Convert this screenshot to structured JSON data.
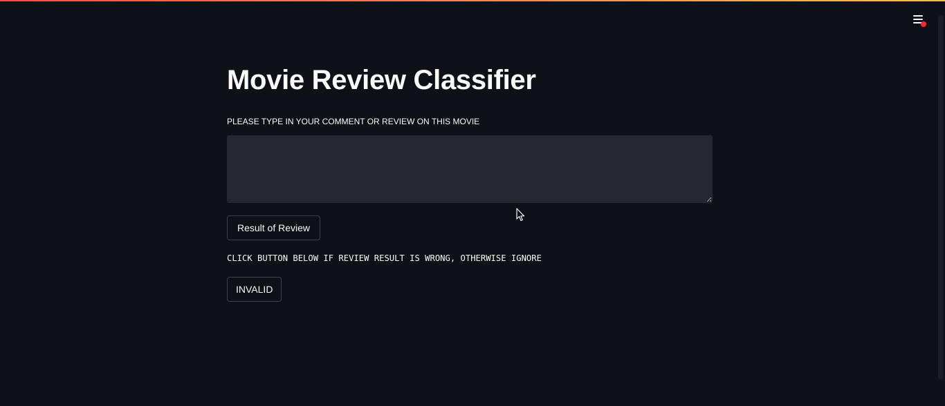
{
  "app": {
    "title": "Movie Review Classifier",
    "accent_gradient": [
      "#ff4b4b",
      "#ffbd45"
    ],
    "background": "#0e1117"
  },
  "menu": {
    "icon": "hamburger-menu-icon",
    "notification": "red-dot"
  },
  "review_input": {
    "label": "PLEASE TYPE IN YOUR COMMENT OR REVIEW ON THIS MOVIE",
    "value": "",
    "placeholder": ""
  },
  "result_button": {
    "label": "Result of Review"
  },
  "instruction": {
    "text": "CLICK BUTTON BELOW IF REVIEW RESULT IS WRONG, OTHERWISE IGNORE"
  },
  "invalid_button": {
    "label": "INVALID"
  }
}
